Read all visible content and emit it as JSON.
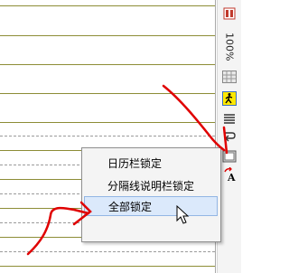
{
  "toolbar": {
    "zoom_label": "100%"
  },
  "menu": {
    "items": [
      {
        "label": "日历栏锁定"
      },
      {
        "label": "分隔线说明栏锁定"
      },
      {
        "label": "全部锁定"
      }
    ]
  },
  "colors": {
    "annotation": "#e00000",
    "hover_bg": "#dbe9fb",
    "line": "#8d8d36"
  }
}
